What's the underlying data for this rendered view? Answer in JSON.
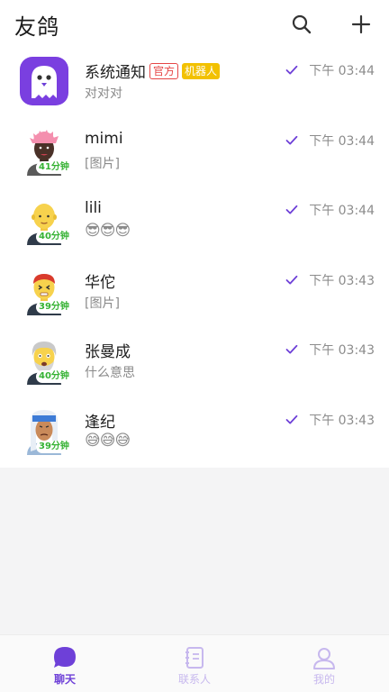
{
  "header": {
    "title": "友鸽",
    "search_icon": "search-icon",
    "add_icon": "plus-icon"
  },
  "chats": [
    {
      "name": "系统通知",
      "tags": [
        "官方",
        "机器人"
      ],
      "preview": "对对对",
      "time": "下午 03:44",
      "badge": "",
      "avatar": "robot-ghost"
    },
    {
      "name": "mimi",
      "tags": [],
      "preview": "[图片]",
      "time": "下午 03:44",
      "badge": "41分钟",
      "avatar": "pink-hair-person"
    },
    {
      "name": "lili",
      "tags": [],
      "preview": "😎😎😎",
      "time": "下午 03:44",
      "badge": "40分钟",
      "avatar": "bald-person"
    },
    {
      "name": "华佗",
      "tags": [],
      "preview": "[图片]",
      "time": "下午 03:43",
      "badge": "39分钟",
      "avatar": "red-hair-person"
    },
    {
      "name": "张曼成",
      "tags": [],
      "preview": "什么意思",
      "time": "下午 03:43",
      "badge": "40分钟",
      "avatar": "grey-hair-person"
    },
    {
      "name": "逢纪",
      "tags": [],
      "preview": "😅😅😅",
      "time": "下午 03:43",
      "badge": "39分钟",
      "avatar": "headwrap-person"
    }
  ],
  "tabbar": {
    "tabs": [
      {
        "label": "聊天",
        "icon": "chat-bubble-icon",
        "active": true
      },
      {
        "label": "联系人",
        "icon": "contacts-book-icon",
        "active": false
      },
      {
        "label": "我的",
        "icon": "user-icon",
        "active": false
      }
    ]
  },
  "colors": {
    "accent": "#6e40d8",
    "badge_green": "#35b233",
    "official_red": "#e64545",
    "bot_yellow": "#f2c100"
  }
}
